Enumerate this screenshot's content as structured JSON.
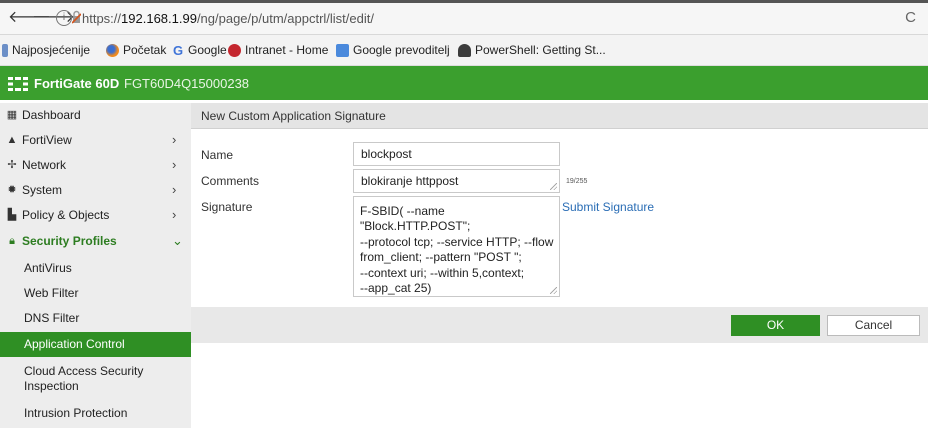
{
  "browser": {
    "url_prefix": "https://",
    "url_host": "192.168.1.99",
    "url_path": "/ng/page/p/utm/appctrl/list/edit/",
    "back_icon": "back-arrow-icon",
    "forward_icon": "forward-arrow-icon",
    "reload_icon": "reload-icon"
  },
  "bookmarks": [
    {
      "label": "Najposjećenije",
      "icon": "bookmark-folder-icon"
    },
    {
      "label": "Početak",
      "icon": "firefox-icon"
    },
    {
      "label": "Google",
      "icon": "google-icon"
    },
    {
      "label": "Intranet - Home",
      "icon": "intranet-icon"
    },
    {
      "label": "Google prevoditelj",
      "icon": "translate-icon"
    },
    {
      "label": "PowerShell: Getting St...",
      "icon": "powershell-icon"
    }
  ],
  "header": {
    "brand": "FortiGate 60D",
    "serial": "FGT60D4Q15000238",
    "color": "#3b9f2e"
  },
  "sidebar": {
    "items": [
      {
        "label": "Dashboard",
        "icon": "dashboard-icon",
        "chevron": ""
      },
      {
        "label": "FortiView",
        "icon": "fortiview-icon",
        "chevron": "›"
      },
      {
        "label": "Network",
        "icon": "network-icon",
        "chevron": "›"
      },
      {
        "label": "System",
        "icon": "gear-icon",
        "chevron": "›"
      },
      {
        "label": "Policy & Objects",
        "icon": "policy-icon",
        "chevron": "›"
      },
      {
        "label": "Security Profiles",
        "icon": "lock-icon",
        "chevron": "⌄"
      }
    ],
    "sub_items": [
      {
        "label": "AntiVirus"
      },
      {
        "label": "Web Filter"
      },
      {
        "label": "DNS Filter"
      },
      {
        "label": "Application Control"
      },
      {
        "label": "Cloud Access Security Inspection"
      },
      {
        "label": "Intrusion Protection"
      }
    ]
  },
  "panel": {
    "title": "New Custom Application Signature"
  },
  "form": {
    "name_label": "Name",
    "name_value": "blockpost",
    "comments_label": "Comments",
    "comments_value": "blokiranje httppost",
    "comments_counter": "19/255",
    "signature_label": "Signature",
    "signature_value": "F-SBID( --name \"Block.HTTP.POST\";\n--protocol tcp; --service HTTP; --flow\nfrom_client; --pattern \"POST \";\n--context uri; --within 5,context;\n--app_cat 25)",
    "submit_link": "Submit Signature"
  },
  "buttons": {
    "ok": "OK",
    "cancel": "Cancel"
  }
}
